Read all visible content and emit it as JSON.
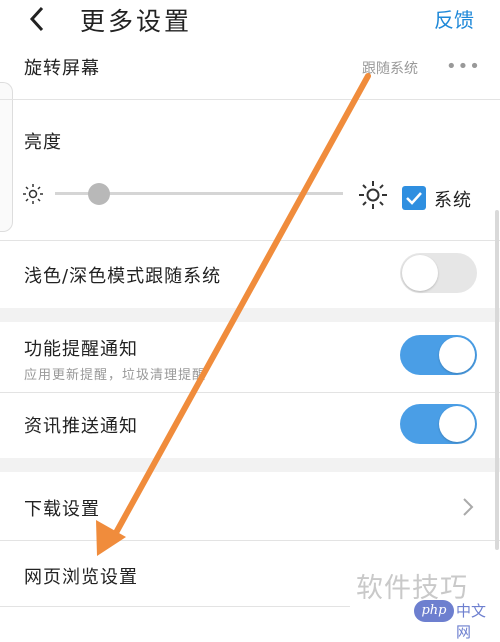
{
  "header": {
    "title": "更多设置",
    "right_link": "反馈",
    "back_icon": "chevron-left-icon"
  },
  "rows": {
    "rotation": {
      "label": "旋转屏幕",
      "value": "跟随系统",
      "more": "•••"
    },
    "brightness": {
      "label": "亮度",
      "level": 0.15,
      "checkbox_label": "系统",
      "checkbox_checked": true
    },
    "theme_follow": {
      "label": "浅色/深色模式跟随系统",
      "toggle_on": false
    },
    "feature_notify": {
      "label": "功能提醒通知",
      "sublabel": "应用更新提醒，垃圾清理提醒",
      "toggle_on": true
    },
    "news_push": {
      "label": "资讯推送通知",
      "toggle_on": true
    },
    "download": {
      "label": "下载设置"
    },
    "web_browse": {
      "label": "网页浏览设置"
    }
  },
  "watermark": {
    "text": "软件技巧",
    "badge_logo": "php",
    "badge_text": "中文网"
  },
  "colors": {
    "accent": "#4a9ee6",
    "link": "#1e88d8",
    "annotation_arrow": "#f08c3c"
  }
}
